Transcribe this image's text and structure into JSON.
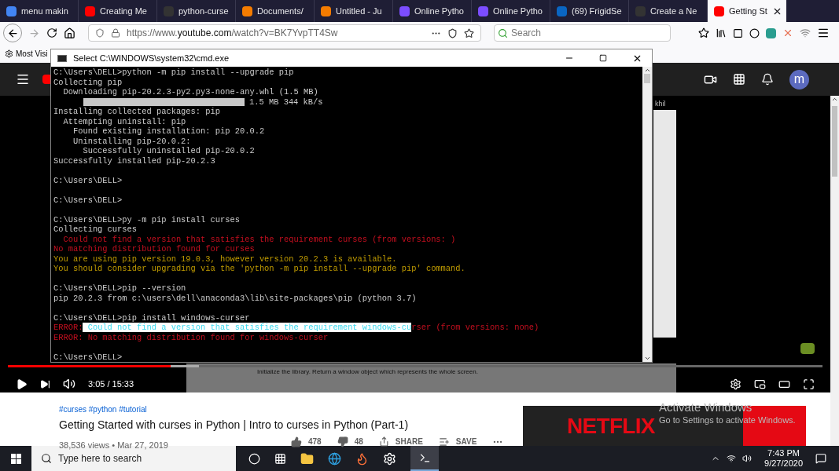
{
  "tabs": [
    {
      "label": "menu makin",
      "selected": false
    },
    {
      "label": "Creating Me",
      "selected": false
    },
    {
      "label": "python-curse",
      "selected": false
    },
    {
      "label": "Documents/",
      "selected": false
    },
    {
      "label": "Untitled - Ju",
      "selected": false
    },
    {
      "label": "Online Pytho",
      "selected": false
    },
    {
      "label": "Online Pytho",
      "selected": false
    },
    {
      "label": "(69) FrigidSe",
      "selected": false
    },
    {
      "label": "Create a Ne",
      "selected": false
    },
    {
      "label": "Getting St",
      "selected": true
    }
  ],
  "address_bar": {
    "url_prefix": "https://www.",
    "url_domain": "youtube.com",
    "url_rest": "/watch?v=BK7YvpTT4Sw"
  },
  "search": {
    "placeholder": "Search"
  },
  "bookmarks": [
    {
      "label": "Most Visi"
    }
  ],
  "cmd_window": {
    "title": "Select C:\\WINDOWS\\system32\\cmd.exe",
    "lines": [
      {
        "kind": "output",
        "text": "C:\\Users\\DELL>python -m pip install --upgrade pip"
      },
      {
        "kind": "output",
        "text": "Collecting pip"
      },
      {
        "kind": "output",
        "text": "  Downloading pip-20.2.3-py2.py3-none-any.whl (1.5 MB)"
      },
      {
        "kind": "progress",
        "level": 1,
        "text": "1.5 MB 344 kB/s"
      },
      {
        "kind": "output",
        "text": "Installing collected packages: pip"
      },
      {
        "kind": "output",
        "text": "  Attempting uninstall: pip"
      },
      {
        "kind": "output",
        "text": "    Found existing installation: pip 20.0.2"
      },
      {
        "kind": "output",
        "text": "    Uninstalling pip-20.0.2:"
      },
      {
        "kind": "output",
        "text": "      Successfully uninstalled pip-20.0.2"
      },
      {
        "kind": "output",
        "text": "Successfully installed pip-20.2.3"
      },
      {
        "kind": "blank"
      },
      {
        "kind": "output",
        "text": "C:\\Users\\DELL>"
      },
      {
        "kind": "blank"
      },
      {
        "kind": "output",
        "text": "C:\\Users\\DELL>"
      },
      {
        "kind": "blank"
      },
      {
        "kind": "output",
        "text": "C:\\Users\\DELL>py -m pip install curses"
      },
      {
        "kind": "output",
        "text": "Collecting curses"
      },
      {
        "kind": "error",
        "text": "  Could not find a version that satisfies the requirement curses (from versions: )"
      },
      {
        "kind": "error",
        "text": "No matching distribution found for curses"
      },
      {
        "kind": "warning",
        "text": "You are using pip version 19.0.3, however version 20.2.3 is available."
      },
      {
        "kind": "warning",
        "text": "You should consider upgrading via the 'python -m pip install --upgrade pip' command."
      },
      {
        "kind": "blank"
      },
      {
        "kind": "output",
        "text": "C:\\Users\\DELL>pip --version"
      },
      {
        "kind": "output",
        "text": "pip 20.2.3 from c:\\users\\dell\\anaconda3\\lib\\site-packages\\pip (python 3.7)"
      },
      {
        "kind": "blank"
      },
      {
        "kind": "output",
        "text": "C:\\Users\\DELL>pip install windows-curser"
      },
      {
        "kind": "error",
        "segments": [
          {
            "text": "ERROR:",
            "selected": false
          },
          {
            "text": " Could not find a version that satisfies the requirement windows-cu",
            "selected": true
          },
          {
            "text": "rser (from versions: none)",
            "selected": false
          }
        ]
      },
      {
        "kind": "error",
        "text": "ERROR: No matching distribution found for windows-curser"
      },
      {
        "kind": "blank"
      },
      {
        "kind": "output",
        "text": "C:\\Users\\DELL>"
      }
    ]
  },
  "youtube": {
    "avatar": "m",
    "side_fragment": "khil",
    "video": {
      "caption": "Initialize the library. Return a window object which represents the whole screen.",
      "level": 0.2,
      "buffer": {
        "level": 0.235
      },
      "time": "3:05 / 15:33"
    },
    "hashtags": "#curses #python #tutorial",
    "title": "Getting Started with curses in Python | Intro to curses in Python (Part-1)",
    "meta": "38,536 views • Mar 27, 2019",
    "likes": "478",
    "dislikes": "48",
    "share": "SHARE",
    "save": "SAVE",
    "ad": {
      "brand": "NETFLIX"
    }
  },
  "activation_notice": {
    "title": "Activate Windows",
    "body": "Go to Settings to activate Windows."
  },
  "taskbar": {
    "search_placeholder": "Type here to search",
    "time": "7:43 PM",
    "date": "9/27/2020"
  }
}
